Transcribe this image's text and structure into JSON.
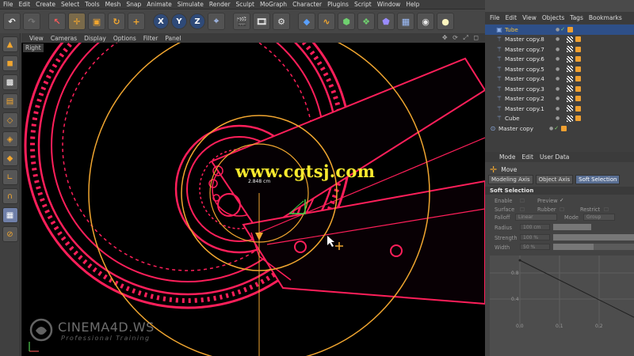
{
  "menubar": {
    "items": [
      "File",
      "Edit",
      "Create",
      "Select",
      "Tools",
      "Mesh",
      "Snap",
      "Animate",
      "Simulate",
      "Render",
      "Sculpt",
      "MoGraph",
      "Character",
      "Plugins",
      "Script",
      "Window",
      "Help"
    ]
  },
  "viewport": {
    "menu": [
      "View",
      "Cameras",
      "Display",
      "Options",
      "Filter",
      "Panel"
    ],
    "label": "Right",
    "watermark": "www.cgtsj.com",
    "measure": "2.848 cm",
    "brand_title": "CINEMA4D.WS",
    "brand_sub": "Professional  Training"
  },
  "objects_panel": {
    "menu": [
      "File",
      "Edit",
      "View",
      "Objects",
      "Tags",
      "Bookmarks"
    ],
    "items": [
      {
        "name": "Tube",
        "type": "primitive"
      },
      {
        "name": "Master copy.8",
        "type": "bone"
      },
      {
        "name": "Master copy.7",
        "type": "bone"
      },
      {
        "name": "Master copy.6",
        "type": "bone"
      },
      {
        "name": "Master copy.5",
        "type": "bone"
      },
      {
        "name": "Master copy.4",
        "type": "bone"
      },
      {
        "name": "Master copy.3",
        "type": "bone"
      },
      {
        "name": "Master copy.2",
        "type": "bone"
      },
      {
        "name": "Master copy.1",
        "type": "bone"
      },
      {
        "name": "Cube",
        "type": "bone"
      },
      {
        "name": "Master copy",
        "type": "null"
      }
    ]
  },
  "attributes": {
    "menu": [
      "Mode",
      "Edit",
      "User Data"
    ],
    "tool": "Move",
    "tabs": [
      "Modeling Axis",
      "Object Axis",
      "Soft Selection"
    ],
    "section": "Soft Selection",
    "enable_label": "Enable",
    "preview_label": "Preview",
    "surface_label": "Surface",
    "rubber_label": "Rubber",
    "restrict_label": "Restrict",
    "falloff_label": "Falloff",
    "falloff_value": "Linear",
    "mode_label": "Mode",
    "mode_value": "Group",
    "radius_label": "Radius",
    "radius_value": "100 cm",
    "strength_label": "Strength",
    "strength_value": "100 %",
    "width_label": "Width",
    "width_value": "50 %",
    "graph_y": [
      "0.8",
      "0.4"
    ],
    "graph_x": [
      "0.0",
      "0.1",
      "0.2"
    ]
  },
  "colors": {
    "accent": "#f1a630",
    "wire": "#ff1f5a",
    "selection": "#2e4f88"
  }
}
